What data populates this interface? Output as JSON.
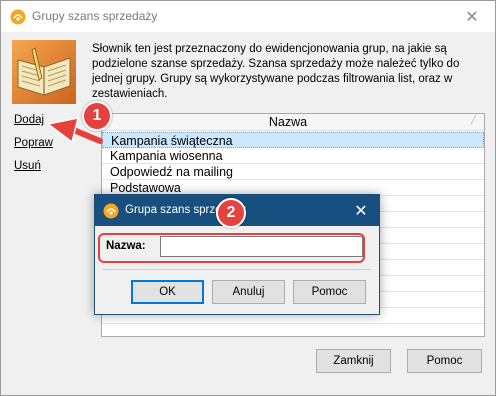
{
  "main_window": {
    "title": "Grupy szans sprzedaży",
    "close_glyph": "✕",
    "description": "Słownik ten jest przeznaczony do ewidencjonowania grup, na jakie są podzielone szanse sprzedaży. Szansa sprzedaży może należeć tylko do jednej grupy. Grupy są wykorzystywane podczas filtrowania list, oraz w zestawieniach.",
    "actions": {
      "add": "Dodaj",
      "edit": "Popraw",
      "delete": "Usuń"
    },
    "list": {
      "column_header": "Nazwa",
      "rows": [
        "Kampania świąteczna",
        "Kampania wiosenna",
        "Odpowiedź na mailing",
        "Podstawowa"
      ]
    },
    "buttons": {
      "close": "Zamknij",
      "help": "Pomoc"
    }
  },
  "dialog": {
    "title": "Grupa szans sprzedaży",
    "close_glyph": "✕",
    "field_label": "Nazwa:",
    "field_value": "",
    "buttons": {
      "ok": "OK",
      "cancel": "Anuluj",
      "help": "Pomoc"
    }
  },
  "annotations": {
    "step1": "1",
    "step2": "2"
  },
  "colors": {
    "annotation_red": "#e5413e",
    "dialog_titlebar": "#17507f",
    "selection": "#cce8ff"
  }
}
